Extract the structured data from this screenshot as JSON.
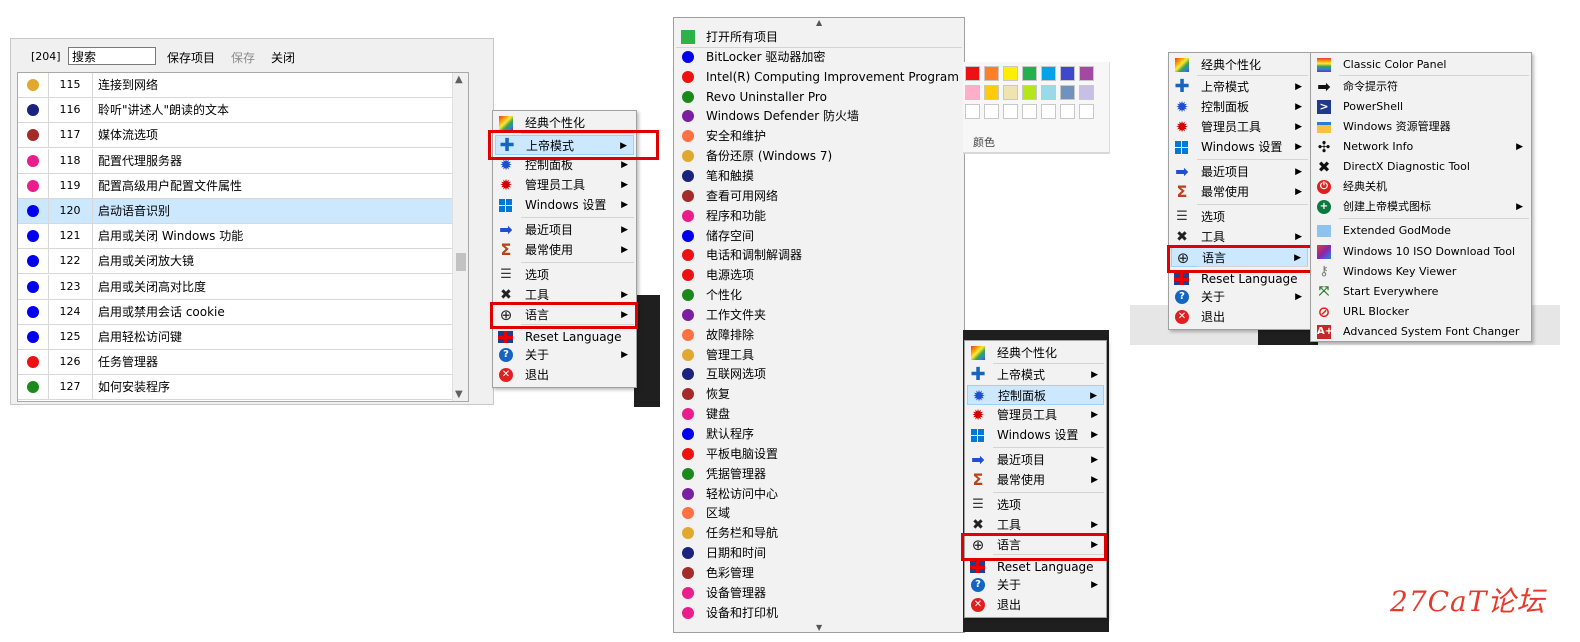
{
  "list_window": {
    "count": "[204]",
    "search_value": "搜索",
    "save_project": "保存项目",
    "save": "保存",
    "close": "关闭",
    "rows": [
      {
        "id": "115",
        "text": "连接到网络",
        "color": "#e0a82e"
      },
      {
        "id": "116",
        "text": "聆听\"讲述人\"朗读的文本",
        "color": "#1a237e"
      },
      {
        "id": "117",
        "text": "媒体流选项",
        "color": "#a52a2a"
      },
      {
        "id": "118",
        "text": "配置代理服务器",
        "color": "#e91e8c"
      },
      {
        "id": "119",
        "text": "配置高级用户配置文件属性",
        "color": "#e91e8c"
      },
      {
        "id": "120",
        "text": "启动语音识别",
        "color": "#0000ee",
        "selected": true
      },
      {
        "id": "121",
        "text": "启用或关闭 Windows 功能",
        "color": "#0000ee"
      },
      {
        "id": "122",
        "text": "启用或关闭放大镜",
        "color": "#0000ee"
      },
      {
        "id": "123",
        "text": "启用或关闭高对比度",
        "color": "#0000ee"
      },
      {
        "id": "124",
        "text": "启用或禁用会话 cookie",
        "color": "#0000ee"
      },
      {
        "id": "125",
        "text": "启用轻松访问键",
        "color": "#0000ee"
      },
      {
        "id": "126",
        "text": "任务管理器",
        "color": "#ee1111"
      },
      {
        "id": "127",
        "text": "如何安装程序",
        "color": "#1b8a1b"
      }
    ]
  },
  "main_menu": {
    "items": [
      {
        "label": "经典个性化",
        "icon": "rainbow-icon"
      },
      {
        "label": "上帝模式",
        "icon": "plus-icon",
        "arrow": true
      },
      {
        "label": "控制面板",
        "icon": "gear-icon",
        "arrow": true
      },
      {
        "label": "管理员工具",
        "icon": "red-gear-icon",
        "arrow": true
      },
      {
        "label": "Windows 设置",
        "icon": "windows-icon",
        "arrow": true
      },
      {
        "label": "最近项目",
        "icon": "arrow-right-icon",
        "arrow": true
      },
      {
        "label": "最常使用",
        "icon": "sigma-icon",
        "arrow": true
      },
      {
        "label": "选项",
        "icon": "sliders-icon"
      },
      {
        "label": "工具",
        "icon": "tools-icon",
        "arrow": true
      },
      {
        "label": "语言",
        "icon": "globe-icon",
        "arrow": true
      },
      {
        "label": "Reset Language",
        "icon": "uk-flag-icon"
      },
      {
        "label": "关于",
        "icon": "help-icon",
        "arrow": true
      },
      {
        "label": "退出",
        "icon": "exit-icon"
      }
    ]
  },
  "long_menu": {
    "items": [
      {
        "label": "打开所有项目",
        "color": "#2db34a",
        "square": true
      },
      {
        "label": "BitLocker 驱动器加密",
        "color": "#0000ee"
      },
      {
        "label": "Intel(R) Computing Improvement Program C...",
        "color": "#ee1111"
      },
      {
        "label": "Revo Uninstaller Pro",
        "color": "#1b8a1b"
      },
      {
        "label": "Windows Defender 防火墙",
        "color": "#7b1fa2"
      },
      {
        "label": "安全和维护",
        "color": "#ff7043"
      },
      {
        "label": "备份还原 (Windows 7)",
        "color": "#e0a82e"
      },
      {
        "label": "笔和触摸",
        "color": "#1a237e"
      },
      {
        "label": "查看可用网络",
        "color": "#a52a2a"
      },
      {
        "label": "程序和功能",
        "color": "#e91e8c"
      },
      {
        "label": "储存空间",
        "color": "#0000ee"
      },
      {
        "label": "电话和调制解调器",
        "color": "#ee1111"
      },
      {
        "label": "电源选项",
        "color": "#ee1111"
      },
      {
        "label": "个性化",
        "color": "#1b8a1b"
      },
      {
        "label": "工作文件夹",
        "color": "#7b1fa2"
      },
      {
        "label": "故障排除",
        "color": "#ff7043"
      },
      {
        "label": "管理工具",
        "color": "#e0a82e"
      },
      {
        "label": "互联网选项",
        "color": "#1a237e"
      },
      {
        "label": "恢复",
        "color": "#a52a2a"
      },
      {
        "label": "键盘",
        "color": "#e91e8c"
      },
      {
        "label": "默认程序",
        "color": "#0000ee"
      },
      {
        "label": "平板电脑设置",
        "color": "#ee1111"
      },
      {
        "label": "凭据管理器",
        "color": "#1b8a1b"
      },
      {
        "label": "轻松访问中心",
        "color": "#7b1fa2"
      },
      {
        "label": "区域",
        "color": "#ff7043"
      },
      {
        "label": "任务栏和导航",
        "color": "#e0a82e"
      },
      {
        "label": "日期和时间",
        "color": "#1a237e"
      },
      {
        "label": "色彩管理",
        "color": "#a52a2a"
      },
      {
        "label": "设备管理器",
        "color": "#e91e8c"
      },
      {
        "label": "设备和打印机",
        "color": "#e91e8c"
      }
    ]
  },
  "palette": {
    "label": "颜色",
    "row1": [
      "#ee1111",
      "#ff7f27",
      "#ffee00",
      "#22b14c",
      "#00a2e8",
      "#3f48cc",
      "#a349a4"
    ],
    "row2": [
      "#ffaec9",
      "#ffc90e",
      "#efe4b0",
      "#b5e61d",
      "#99d9ea",
      "#7092be",
      "#c8bfe7"
    ]
  },
  "tools_submenu": {
    "items": [
      {
        "label": "Classic Color Panel",
        "icon": "color-panel-icon"
      },
      {
        "label": "命令提示符",
        "icon": "command-arrow-icon"
      },
      {
        "label": "PowerShell",
        "icon": "powershell-icon"
      },
      {
        "label": "Windows 资源管理器",
        "icon": "folder-icon"
      },
      {
        "label": "Network Info",
        "icon": "network-icon",
        "arrow": true
      },
      {
        "label": "DirectX Diagnostic Tool",
        "icon": "directx-icon"
      },
      {
        "label": "经典关机",
        "icon": "power-icon"
      },
      {
        "label": "创建上帝模式图标",
        "icon": "add-circle-icon",
        "arrow": true
      },
      {
        "label": "Extended GodMode",
        "icon": "godmode-icon"
      },
      {
        "label": "Windows 10 ISO Download Tool",
        "icon": "iso-icon"
      },
      {
        "label": "Windows Key Viewer",
        "icon": "key-icon"
      },
      {
        "label": "Start Everywhere",
        "icon": "start-icon"
      },
      {
        "label": "URL Blocker",
        "icon": "block-icon"
      },
      {
        "label": "Advanced System Font Changer",
        "icon": "font-icon"
      }
    ]
  },
  "watermark": "27CaT论坛"
}
